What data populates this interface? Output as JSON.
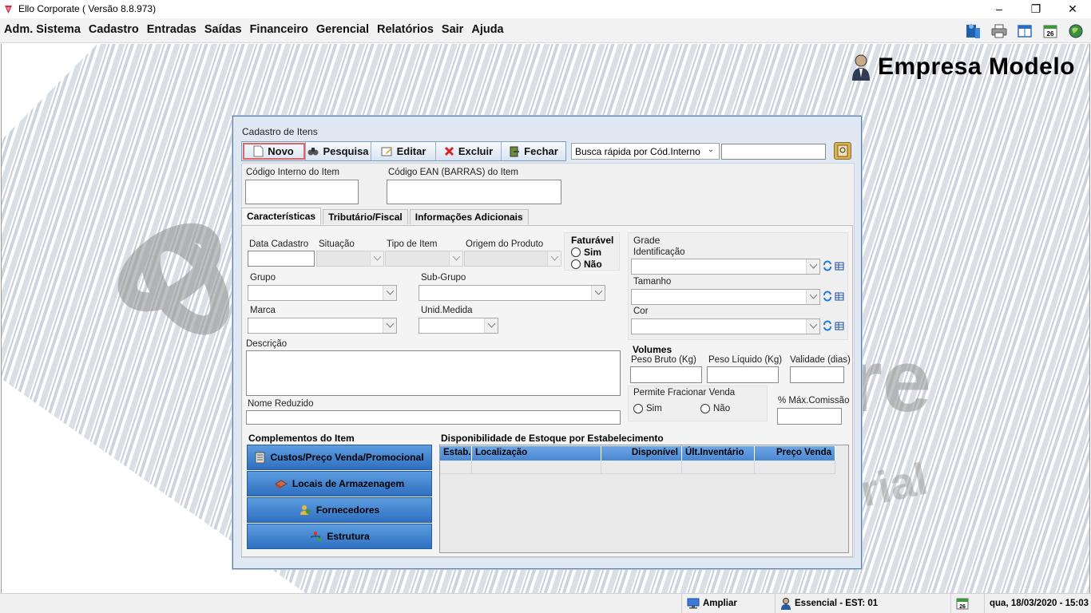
{
  "window": {
    "title": "Ello Corporate ( Versão 8.8.973)"
  },
  "menu": [
    "Adm. Sistema",
    "Cadastro",
    "Entradas",
    "Saídas",
    "Financeiro",
    "Gerencial",
    "Relatórios",
    "Sair",
    "Ajuda"
  ],
  "menu_tools": {
    "calendar_day": "26"
  },
  "brand": {
    "company": "Empresa Modelo"
  },
  "dialog": {
    "title": "Cadastro de Itens",
    "toolbar": {
      "novo": "Novo",
      "pesquisa": "Pesquisa",
      "editar": "Editar",
      "excluir": "Excluir",
      "fechar": "Fechar"
    },
    "quick_search": {
      "selected": "Busca rápida por Cód.Interno",
      "value": ""
    },
    "fields": {
      "codigo_interno_label": "Código Interno do Item",
      "codigo_ean_label": "Código EAN (BARRAS)  do Item"
    },
    "tabs": [
      "Características",
      "Tributário/Fiscal",
      "Informações Adicionais"
    ],
    "caracteristicas": {
      "data_cadastro": "Data Cadastro",
      "situacao": "Situação",
      "tipo_item": "Tipo de Item",
      "origem_produto": "Origem do Produto",
      "faturavel": "Faturável",
      "sim": "Sim",
      "nao": "Não",
      "grupo": "Grupo",
      "sub_grupo": "Sub-Grupo",
      "marca": "Marca",
      "unid_medida": "Unid.Medida",
      "descricao": "Descrição",
      "nome_reduzido": "Nome Reduzido",
      "grade": "Grade",
      "identificacao": "Identificação",
      "tamanho": "Tamanho",
      "cor": "Cor",
      "volumes": "Volumes",
      "peso_bruto": "Peso Bruto (Kg)",
      "peso_liquido": "Peso Líquido (Kg)",
      "validade": "Validade (dias)",
      "permite_fracionar": "Permite Fracionar Venda",
      "fracionar_sim": "Sim",
      "fracionar_nao": "Não",
      "max_comissao": "% Máx.Comissão"
    },
    "complementos": {
      "title": "Complementos do Item",
      "buttons": [
        "Custos/Preço Venda/Promocional",
        "Locais de Armazenagem",
        "Fornecedores",
        "Estrutura"
      ]
    },
    "estoque": {
      "title": "Disponibilidade de Estoque por Estabelecimento",
      "columns": [
        "Estab.",
        "Localização",
        "Disponível",
        "Últ.Inventário",
        "Preço Venda"
      ]
    }
  },
  "statusbar": {
    "ampliar": "Ampliar",
    "user": "Essencial - EST: 01",
    "calendar_day": "26",
    "datetime": "qua, 18/03/2020  -  15:03"
  }
}
